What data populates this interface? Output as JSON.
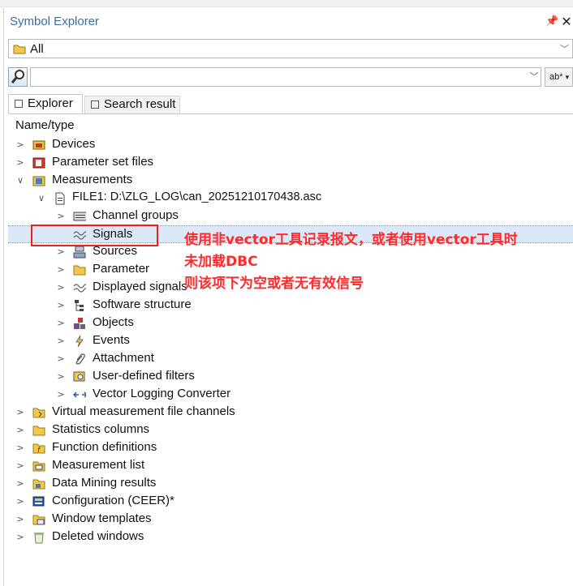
{
  "panel": {
    "title": "Symbol Explorer"
  },
  "filter": {
    "selected": "All"
  },
  "search": {
    "value": "",
    "mode_label": "ab*"
  },
  "tabs": [
    {
      "label": "Explorer"
    },
    {
      "label": "Search result"
    }
  ],
  "tree": {
    "header": "Name/type",
    "items": [
      {
        "label": "Devices"
      },
      {
        "label": "Parameter set files"
      },
      {
        "label": "Measurements"
      },
      {
        "label": "FILE1: D:\\ZLG_LOG\\can_20251210170438.asc"
      },
      {
        "label": "Channel groups"
      },
      {
        "label": "Signals"
      },
      {
        "label": "Sources"
      },
      {
        "label": "Parameter"
      },
      {
        "label": "Displayed signals"
      },
      {
        "label": "Software structure"
      },
      {
        "label": "Objects"
      },
      {
        "label": "Events"
      },
      {
        "label": "Attachment"
      },
      {
        "label": "User-defined filters"
      },
      {
        "label": "Vector Logging Converter"
      },
      {
        "label": "Virtual measurement file channels"
      },
      {
        "label": "Statistics columns"
      },
      {
        "label": "Function definitions"
      },
      {
        "label": "Measurement list"
      },
      {
        "label": "Data Mining results"
      },
      {
        "label": "Configuration (CEER)*"
      },
      {
        "label": "Window templates"
      },
      {
        "label": "Deleted windows"
      }
    ]
  },
  "annotation": {
    "line1": "使用非vector工具记录报文，或者使用vector工具时",
    "line2": "未加载DBC",
    "line3": "则该项下为空或者无有效信号",
    "color": "#ff2a2a"
  },
  "colors": {
    "title": "#3a6ea5",
    "selection": "#dbe8f8",
    "highlight_box": "#e8231e"
  }
}
